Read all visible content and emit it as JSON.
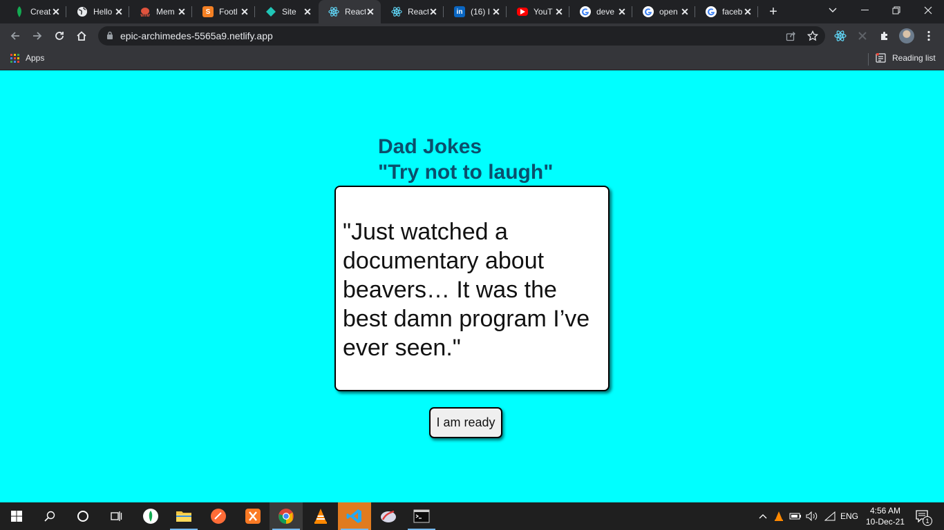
{
  "browser": {
    "tabs": [
      {
        "title": "Creat",
        "icon": "mongodb-leaf-icon",
        "color": "#13aa52"
      },
      {
        "title": "Hello",
        "icon": "globe-icon",
        "color": "#e8eaed"
      },
      {
        "title": "Mem",
        "icon": "octopus-icon",
        "color": "#e0533d"
      },
      {
        "title": "Footl",
        "icon": "letter-s-icon",
        "color": "#f48024"
      },
      {
        "title": "Site",
        "icon": "netlify-diamond-icon",
        "color": "#20c6b7"
      },
      {
        "title": "React",
        "icon": "react-atom-icon",
        "color": "#61dafb",
        "active": true
      },
      {
        "title": "React",
        "icon": "react-atom-icon",
        "color": "#61dafb"
      },
      {
        "title": "(16) I",
        "icon": "linkedin-icon",
        "color": "#0a66c2"
      },
      {
        "title": "YouT",
        "icon": "youtube-icon",
        "color": "#ff0000"
      },
      {
        "title": "deve",
        "icon": "google-icon",
        "color": "#ffffff"
      },
      {
        "title": "open",
        "icon": "google-icon",
        "color": "#ffffff"
      },
      {
        "title": "faceb",
        "icon": "google-icon",
        "color": "#ffffff"
      }
    ],
    "url": "epic-archimedes-5565a9.netlify.app",
    "bookmarks": {
      "apps_label": "Apps",
      "reading_list_label": "Reading list"
    }
  },
  "page": {
    "title": "Dad Jokes",
    "subtitle": "\"Try not to laugh\"",
    "joke": "\"Just watched a documentary about beavers… It was the best damn program I’ve ever seen.\"",
    "button_label": "I am ready",
    "background_color": "#00ffff",
    "heading_color": "#0b4f6c"
  },
  "taskbar": {
    "language": "ENG",
    "time": "4:56 AM",
    "date": "10-Dec-21",
    "notification_count": "1"
  }
}
